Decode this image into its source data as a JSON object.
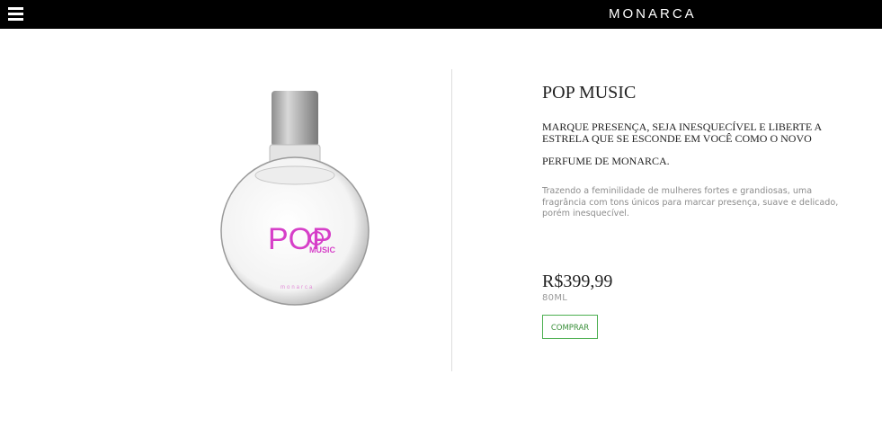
{
  "header": {
    "brand": "MONARCA"
  },
  "product": {
    "title": "POP MUSIC",
    "tagline_line1": "MARQUE PRESENÇA, SEJA INESQUECÍVEL E LIBERTE A ESTRELA QUE SE ESCONDE EM VOCÊ COMO O NOVO",
    "tagline_line2": "PERFUME DE MONARCA.",
    "description": "Trazendo a feminilidade de mulheres fortes e grandiosas, uma fragrância com tons únicos para marcar presença, suave e delicado, porém inesquecível.",
    "price": "R$399,99",
    "volume": "80ML",
    "buy_label": "COMPRAR",
    "bottle_logo": "POP",
    "bottle_logo_sub": "MUSIC",
    "bottle_brand": "monarca"
  },
  "colors": {
    "header_bg": "#000000",
    "accent_green": "#4caf50",
    "logo_pink": "#d63fc8"
  },
  "icons": {
    "menu": "hamburger-menu-icon"
  }
}
